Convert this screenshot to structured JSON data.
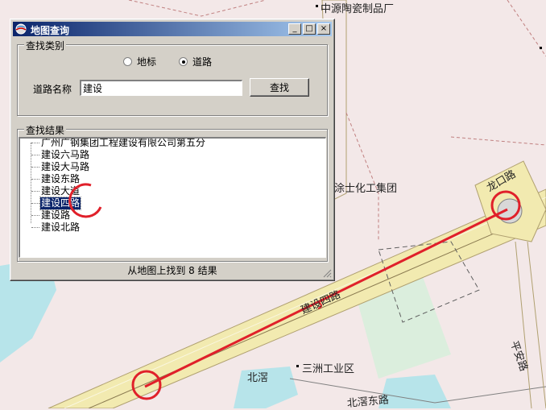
{
  "map": {
    "labels": {
      "ceramic": "中源陶瓷制品厂",
      "coating": "美涂士化工集团",
      "road_label": "建设四路",
      "longkou": "龙口路",
      "sanzhou": "三洲工业区",
      "beijiao": "北滘",
      "beijiao_east": "北滘东路",
      "ping": "平安路"
    }
  },
  "dialog": {
    "title": "地图查询",
    "controls": {
      "minimize": "_",
      "maximize": "□",
      "close": "×"
    },
    "search_type": {
      "legend": "查找类别",
      "options": [
        {
          "label": "地标",
          "selected": false
        },
        {
          "label": "道路",
          "selected": true
        }
      ]
    },
    "road_name_label": "道路名称",
    "road_name_value": "建设",
    "find_button": "查找",
    "results": {
      "legend": "查找结果",
      "items": [
        "广州广钢集团工程建设有限公司第五分",
        "建设六马路",
        "建设大马路",
        "建设东路",
        "建设大道",
        "建设四路",
        "建设路",
        "建设北路"
      ],
      "selected_index": 5
    },
    "status": "从地图上找到 8 结果"
  }
}
